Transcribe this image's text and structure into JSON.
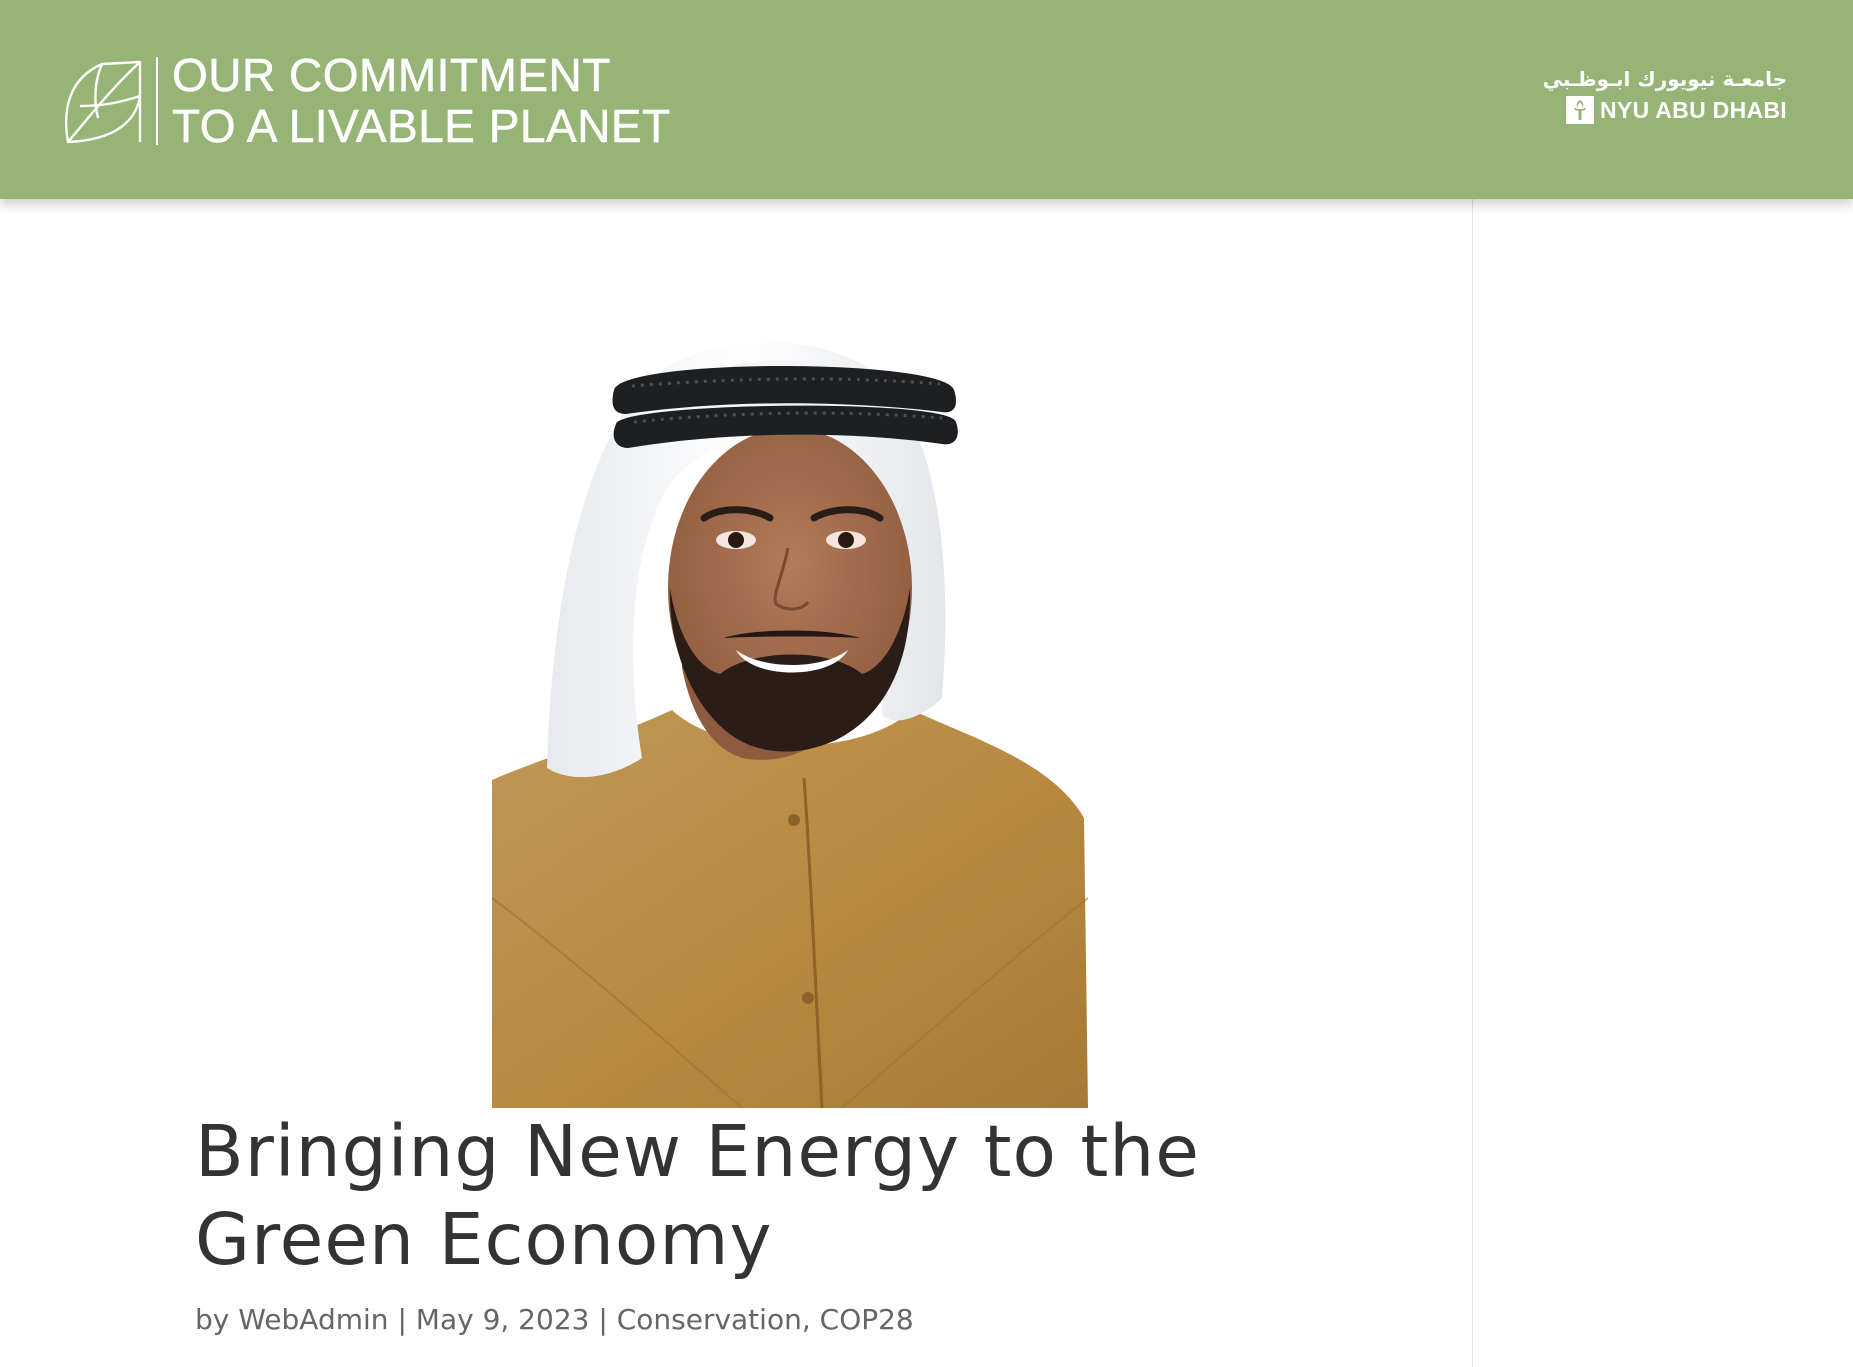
{
  "header": {
    "title_line1": "OUR COMMITMENT",
    "title_line2": "TO A LIVABLE PLANET",
    "logo_icon": "leaf-icon",
    "nyu": {
      "arabic": "جامعـة نيويورك ابـوظـبي",
      "name": "NYU ABU DHABI",
      "icon": "torch-icon"
    },
    "background_color": "#96b476"
  },
  "post": {
    "title": "Bringing New Energy to the Green Economy",
    "meta": {
      "prefix": "by",
      "author": "WebAdmin",
      "separator": "|",
      "date": "May 9, 2023",
      "category_1": "Conservation",
      "category_sep": ",",
      "category_2": "COP28"
    }
  }
}
